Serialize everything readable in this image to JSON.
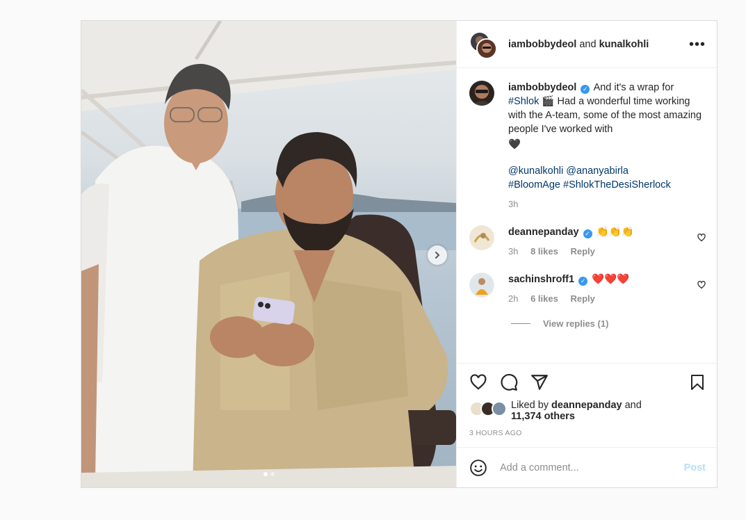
{
  "post": {
    "header": {
      "user1": "iambobbydeol",
      "conjunction": "and",
      "user2": "kunalkohli",
      "more": "•••"
    },
    "caption": {
      "username": "iambobbydeol",
      "text_part1": "And it's a wrap for",
      "hashtag_shlok": "#Shlok",
      "clapper": "🎬",
      "text_part2": "Had a wonderful time working with the A-team, some of the most amazing people I've worked with",
      "heart": "🖤",
      "mention1": "@kunalkohli",
      "mention2": "@ananyabirla",
      "hashtag2": "#BloomAge",
      "hashtag3": "#ShlokTheDesiSherlock",
      "time": "3h"
    },
    "comments": [
      {
        "username": "deannepanday",
        "text": "👏👏👏",
        "time": "3h",
        "likes": "8 likes",
        "reply": "Reply"
      },
      {
        "username": "sachinshroff1",
        "text": "❤️❤️❤️",
        "time": "2h",
        "likes": "6 likes",
        "reply": "Reply"
      }
    ],
    "view_replies": "View replies (1)",
    "liked_by": {
      "prefix": "Liked by",
      "user": "deannepanday",
      "and": "and",
      "others": "11,374 others"
    },
    "timestamp": "3 HOURS AGO",
    "comment_box": {
      "placeholder": "Add a comment...",
      "post_label": "Post"
    },
    "colors": {
      "link": "#00376b",
      "verified": "#3897f0",
      "post_button": "#b2dffc",
      "muted": "#8e8e8e"
    },
    "carousel": {
      "slides": 2,
      "active_index": 0
    },
    "icons": [
      "more-icon",
      "verified-icon",
      "heart-icon",
      "comment-icon",
      "share-icon",
      "bookmark-icon",
      "emoji-icon",
      "next-arrow-icon"
    ]
  }
}
